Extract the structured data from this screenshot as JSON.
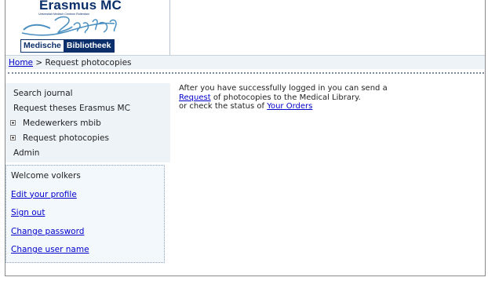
{
  "logo": {
    "title": "Erasmus MC",
    "subtitle": "Universitair Medisch Centrum Rotterdam",
    "bar_left": "Medische",
    "bar_right": "Bibliotheek",
    "colors": {
      "navy": "#0b2f6a",
      "teal": "#4a8fc0"
    }
  },
  "breadcrumb": {
    "home_label": "Home",
    "separator": ">",
    "current": "Request photocopies"
  },
  "nav": {
    "items": [
      {
        "label": "Search journal",
        "expandable": false
      },
      {
        "label": "Request theses Erasmus MC",
        "expandable": false
      },
      {
        "label": "Medewerkers mbib",
        "expandable": true
      },
      {
        "label": "Request photocopies",
        "expandable": true
      },
      {
        "label": "Admin",
        "expandable": false
      }
    ]
  },
  "user_panel": {
    "welcome": "Welcome volkers",
    "links": [
      "Edit your profile",
      "Sign out",
      "Change password",
      "Change user name"
    ]
  },
  "content": {
    "line1": "After you have successfully logged in you can send a",
    "request_link": "Request",
    "line2_rest": "of photocopies to the Medical Library.",
    "line3_prefix": "or check the status of",
    "orders_link": "Your Orders"
  },
  "colors": {
    "panel_bg": "#eef3f8",
    "link": "#0000cc"
  }
}
